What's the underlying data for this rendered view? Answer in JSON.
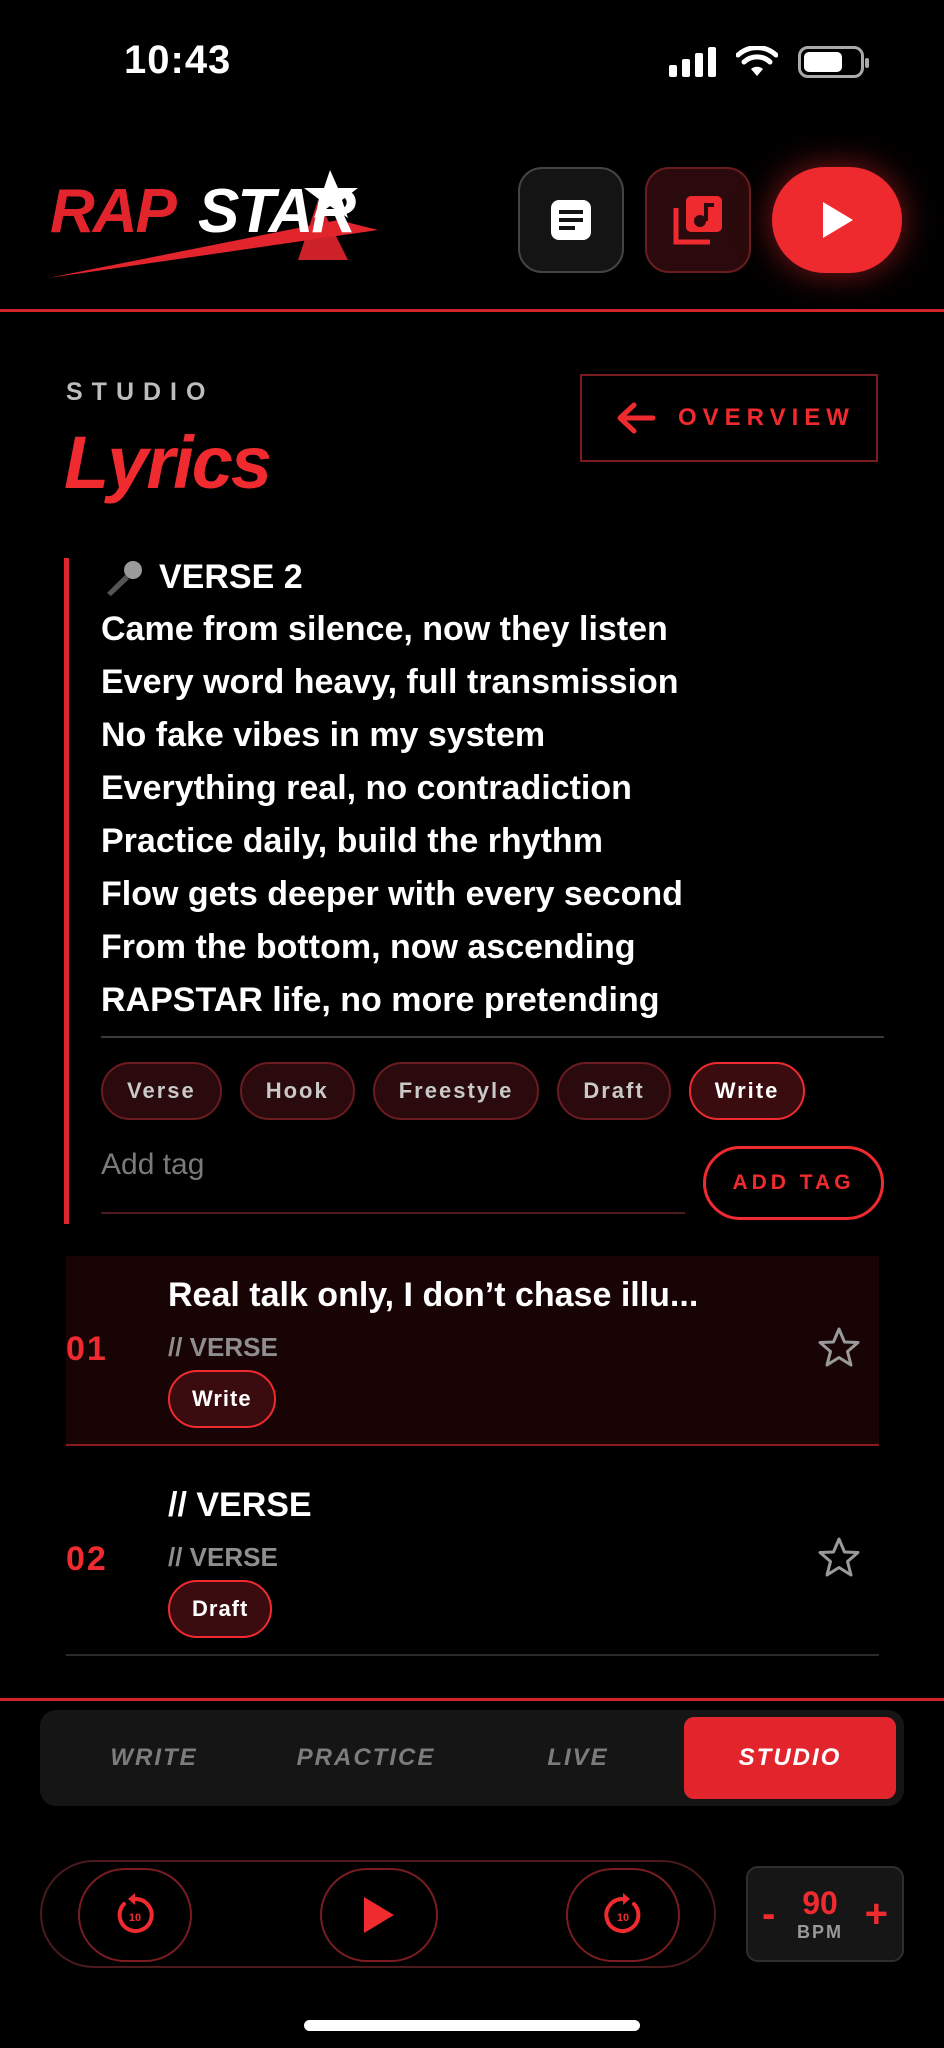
{
  "status_bar": {
    "time": "10:43"
  },
  "header": {
    "logo_text": "RAPSTAR",
    "buttons": [
      "doc-icon",
      "music-library-icon",
      "play-icon"
    ]
  },
  "page": {
    "kicker": "STUDIO",
    "title": "Lyrics",
    "overview_label": "OVERVIEW"
  },
  "lyrics": {
    "section": "VERSE 2",
    "lines": [
      "Came from silence, now they listen",
      "Every word heavy, full transmission",
      "No fake vibes in my system",
      "Everything real, no contradiction",
      "Practice daily, build the rhythm",
      "Flow gets deeper with every second",
      "From the bottom, now ascending",
      "RAPSTAR life, no more pretending"
    ],
    "tags": [
      "Verse",
      "Hook",
      "Freestyle",
      "Draft",
      "Write"
    ],
    "selected_tag": "Write",
    "add_tag_placeholder": "Add tag",
    "add_tag_label": "ADD TAG"
  },
  "list": [
    {
      "num": "01",
      "title": "Real talk only, I don’t chase illu...",
      "sub": "// VERSE",
      "tag": "Write"
    },
    {
      "num": "02",
      "title": "// VERSE",
      "sub": "// VERSE",
      "tag": "Draft"
    }
  ],
  "nav": {
    "tabs": [
      "WRITE",
      "PRACTICE",
      "LIVE",
      "STUDIO"
    ],
    "active": "STUDIO"
  },
  "player": {
    "skip_back_label": "10",
    "skip_forward_label": "10",
    "bpm_minus": "-",
    "bpm_value": "90",
    "bpm_unit": "BPM",
    "bpm_plus": "+"
  },
  "colors": {
    "accent": "#ef2b30",
    "dark_accent": "#2a0a0c",
    "background": "#000000"
  }
}
